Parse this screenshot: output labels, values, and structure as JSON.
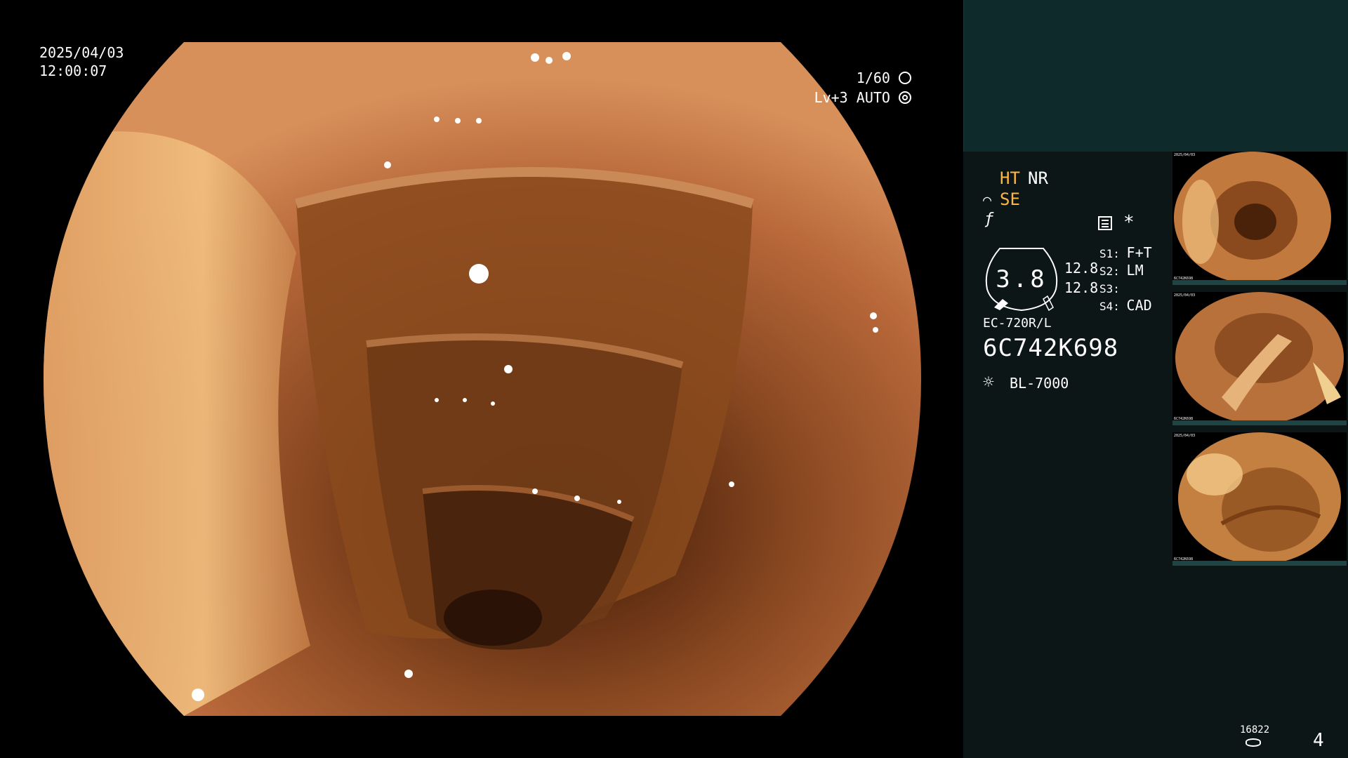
{
  "overlay": {
    "date": "2025/04/03",
    "time": "12:00:07",
    "shutter": "1/60",
    "shutter_icon": "aperture-icon",
    "level": "Lv+3",
    "mode": "AUTO",
    "mode_icon": "iris-icon"
  },
  "side": {
    "ht": "HT",
    "nr": "NR",
    "se": "SE",
    "se_icon": "bent-tip-icon",
    "freeze_icon": "slashed-f-icon",
    "memo_icon": "memo-icon",
    "asterisk": "*",
    "gauge_value": "3.8",
    "gauge_sub1": "12.8",
    "gauge_sub2": "12.8",
    "switches": [
      {
        "key": "S1:",
        "value": "F+T"
      },
      {
        "key": "S2:",
        "value": "LM"
      },
      {
        "key": "S3:",
        "value": ""
      },
      {
        "key": "S4:",
        "value": "CAD"
      }
    ],
    "scope_model": "EC-720R/L",
    "serial": "6C742K698",
    "light_source": "BL-7000",
    "light_icon": "lamp-icon",
    "disk_count": "16822",
    "disk_icon": "disk-icon",
    "image_count": "4"
  },
  "colors": {
    "panel_bg": "#0d1616",
    "panel_top": "#0f2a2a",
    "accent_yellow": "#ffb640",
    "thumb_bar": "#1e4444"
  },
  "thumbnails": [
    {
      "line1": "2025/04/03",
      "line2": "6C742K698"
    },
    {
      "line1": "2025/04/03",
      "line2": "6C742K698"
    },
    {
      "line1": "2025/04/03",
      "line2": "6C742K698"
    }
  ]
}
